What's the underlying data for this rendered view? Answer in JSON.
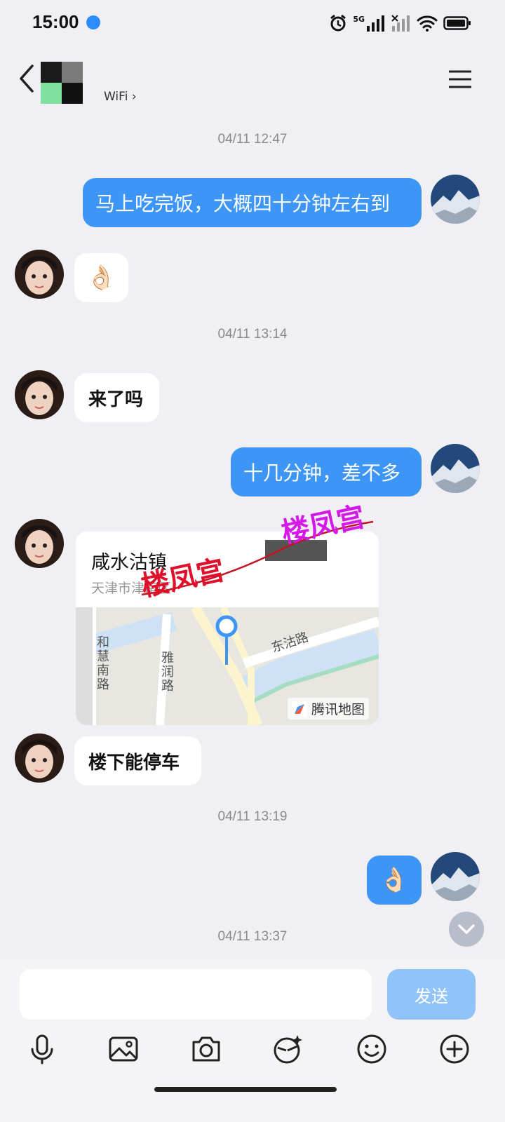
{
  "status_bar": {
    "time": "15:00",
    "network": "5G"
  },
  "header": {
    "subtitle": "WiFi",
    "chevron": "›"
  },
  "messages": [
    {
      "type": "timestamp",
      "text": "04/11 12:47"
    },
    {
      "type": "outgoing",
      "text": "马上吃完饭，大概四十分钟左右到"
    },
    {
      "type": "incoming",
      "text": "👌🏻"
    },
    {
      "type": "timestamp",
      "text": "04/11 13:14"
    },
    {
      "type": "incoming",
      "text": "来了吗"
    },
    {
      "type": "outgoing",
      "text": "十几分钟，差不多"
    },
    {
      "type": "location",
      "name": "咸水沽镇",
      "address": "天津市津南区"
    },
    {
      "type": "incoming",
      "text": "楼下能停车"
    },
    {
      "type": "timestamp",
      "text": "04/11 13:19"
    },
    {
      "type": "outgoing",
      "text": "👌🏻"
    },
    {
      "type": "timestamp",
      "text": "04/11 13:37"
    }
  ],
  "location_card": {
    "name": "咸水沽镇",
    "address": "天津市津南区",
    "map_labels": {
      "road1": "和慧南路",
      "road2": "雅润路",
      "road3": "东沽路"
    },
    "map_brand": "腾讯地图"
  },
  "watermarks": [
    "楼凤宫",
    "楼凤宫"
  ],
  "input": {
    "placeholder": "",
    "send_label": "发送"
  },
  "toolbar": [
    "mic-icon",
    "image-icon",
    "camera-icon",
    "sticker-icon",
    "emoji-icon",
    "plus-icon"
  ],
  "colors": {
    "outgoing_bubble": "#3d96f5",
    "send_button": "#90c4f8",
    "watermark_red": "#e0102a",
    "watermark_magenta": "#d418e8"
  }
}
